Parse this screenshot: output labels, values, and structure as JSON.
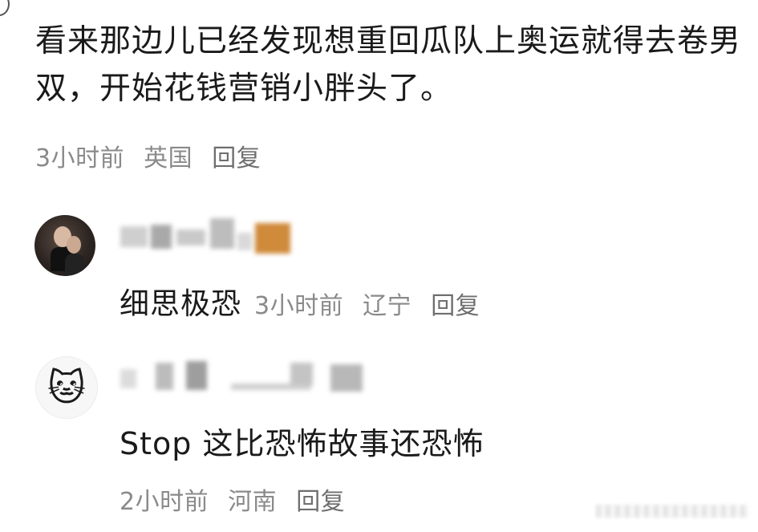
{
  "main_comment": {
    "text": "看来那边儿已经发现想重回瓜队上奥运就得去卷男双，开始花钱营销小胖头了。",
    "time": "3小时前",
    "location": "英国",
    "reply_label": "回复"
  },
  "replies": [
    {
      "avatar_icon": "person-photo",
      "text": "细思极恐",
      "time": "3小时前",
      "location": "辽宁",
      "reply_label": "回复"
    },
    {
      "avatar_icon": "cat-face-icon",
      "avatar_glyph": "🐱",
      "text": "Stop  这比恐怖故事还恐怖",
      "time": "2小时前",
      "location": "河南",
      "reply_label": "回复"
    }
  ],
  "colors": {
    "text": "#1a1a1a",
    "meta": "#8a8a8a",
    "background": "#ffffff"
  }
}
